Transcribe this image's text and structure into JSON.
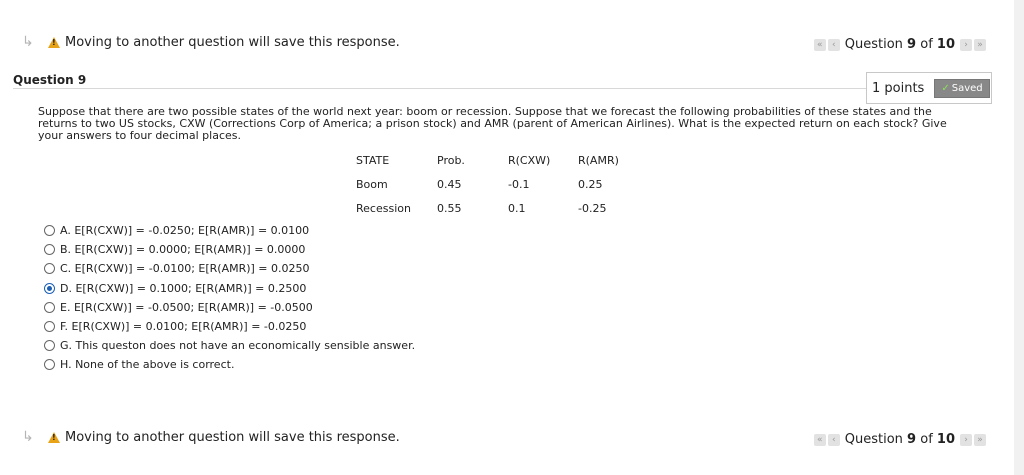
{
  "notice": {
    "text": "Moving to another question will save this response."
  },
  "question_nav": {
    "prefix": "Question",
    "current": "9",
    "of": "of",
    "total": "10"
  },
  "question": {
    "title": "Question 9",
    "points": "1 points",
    "saved": "Saved",
    "prompt": "Suppose that there are two possible states of the world next year: boom or recession. Suppose that we forecast the following probabilities of these states and the returns to two US stocks, CXW (Corrections Corp of America; a prison stock) and AMR (parent of American Airlines). What is the expected return on each stock? Give your answers to four decimal places."
  },
  "table": {
    "headers": [
      "STATE",
      "Prob.",
      "R(CXW)",
      "R(AMR)"
    ],
    "rows": [
      [
        "Boom",
        "0.45",
        "-0.1",
        "0.25"
      ],
      [
        "Recession",
        "0.55",
        "0.1",
        "-0.25"
      ]
    ]
  },
  "options": [
    "A. E[R(CXW)] = -0.0250; E[R(AMR)] = 0.0100",
    "B. E[R(CXW)] = 0.0000; E[R(AMR)] = 0.0000",
    "C. E[R(CXW)] = -0.0100; E[R(AMR)] = 0.0250",
    "D. E[R(CXW)] = 0.1000; E[R(AMR)] = 0.2500",
    "E. E[R(CXW)] = -0.0500; E[R(AMR)] = -0.0500",
    "F. E[R(CXW)] = 0.0100; E[R(AMR)] = -0.0250",
    "G. This queston does not have an economically sensible answer.",
    "H. None of the above is correct."
  ],
  "selected_option": "D",
  "colors": {
    "accent": "#1a5fb4",
    "warning": "#e8a317",
    "saved_bg": "#888888"
  }
}
